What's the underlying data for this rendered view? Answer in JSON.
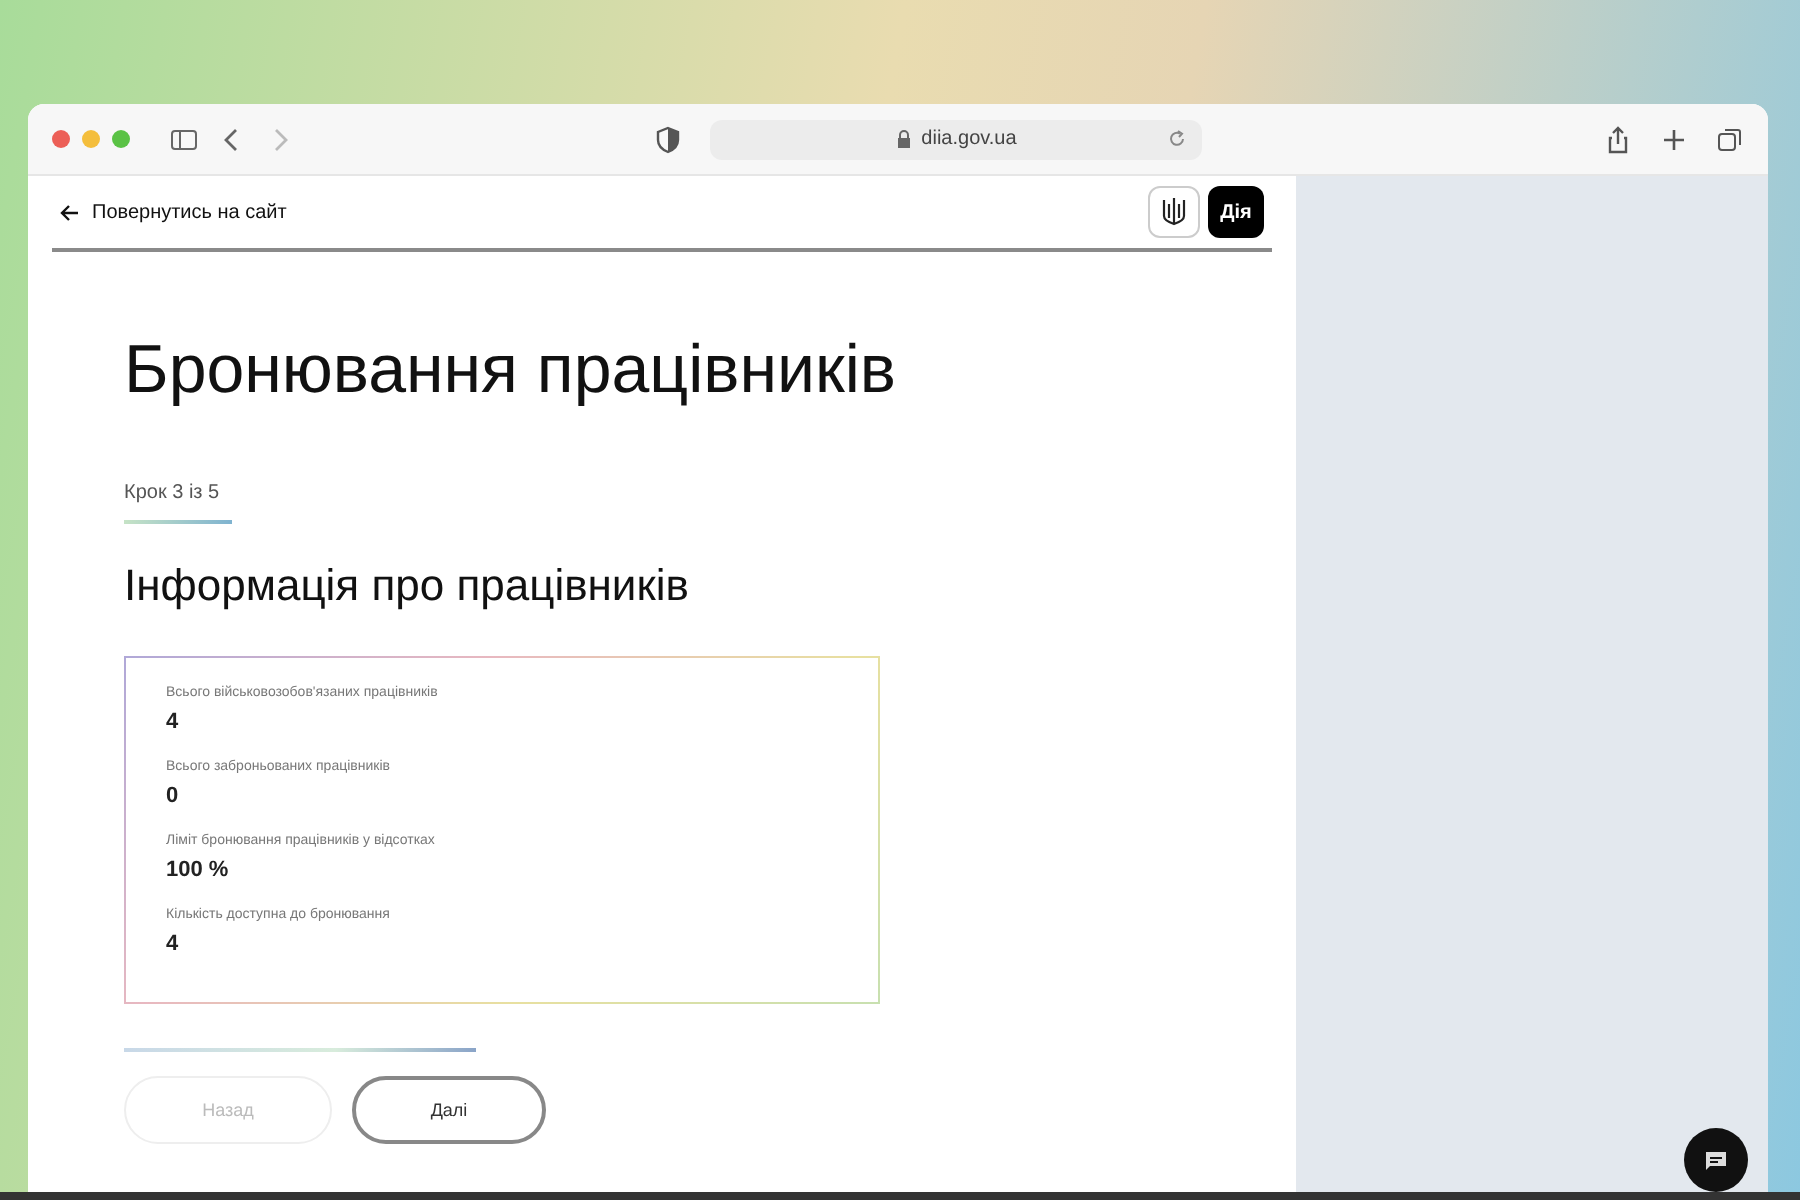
{
  "browser": {
    "url": "diia.gov.ua"
  },
  "header": {
    "back_link": "Повернутись на сайт",
    "logo": "Дія"
  },
  "title": "Бронювання працівників",
  "step": "Крок 3 із 5",
  "section_title": "Інформація про працівників",
  "fields": [
    {
      "label": "Всього військовозобов'язаних працівників",
      "value": "4"
    },
    {
      "label": "Всього заброньованих працівників",
      "value": "0"
    },
    {
      "label": "Ліміт бронювання працівників у відсотках",
      "value": "100 %"
    },
    {
      "label": "Кількість доступна до бронювання",
      "value": "4"
    }
  ],
  "buttons": [
    {
      "label": "Назад",
      "disabled": true
    },
    {
      "label": "Далі",
      "disabled": false
    }
  ]
}
